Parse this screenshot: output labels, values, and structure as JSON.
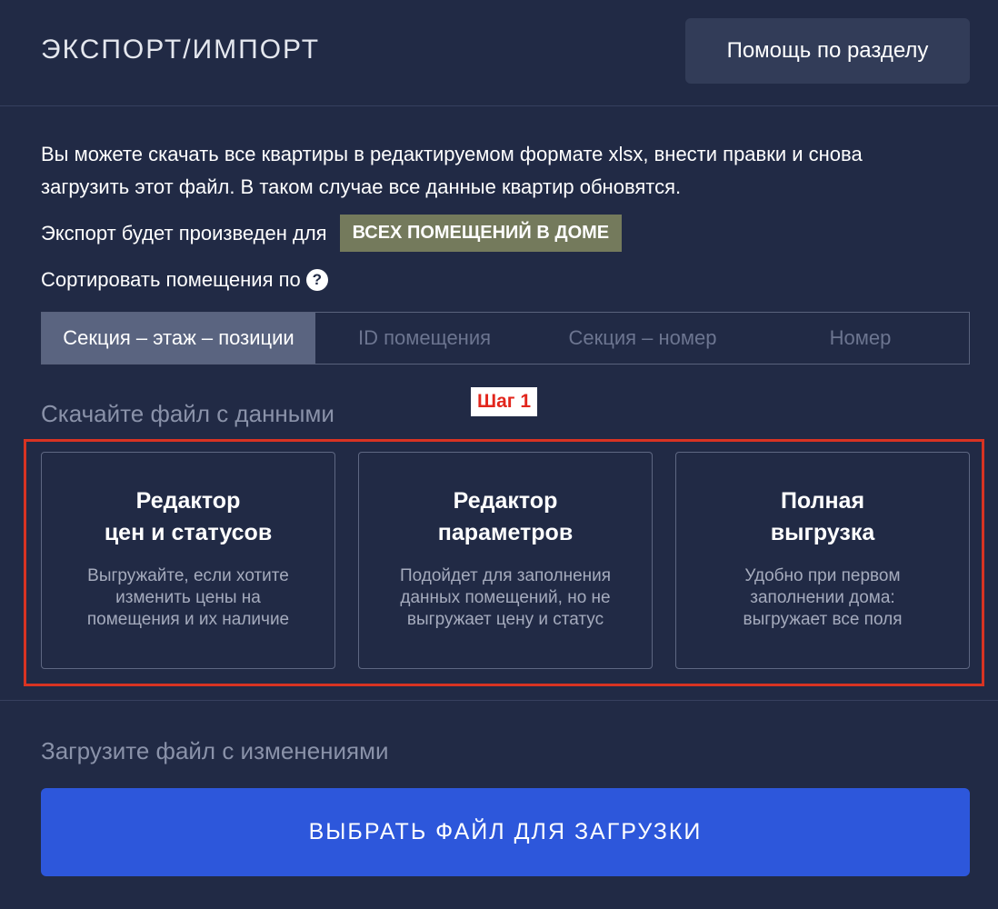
{
  "header": {
    "title": "ЭКСПОРТ/ИМПОРТ",
    "help_button": "Помощь по разделу"
  },
  "description": {
    "line1": "Вы можете скачать все квартиры в редактируемом формате xlsx, внести правки и снова",
    "line2": "загрузить этот файл. В таком случае все данные квартир обновятся."
  },
  "export_scope": {
    "label": "Экспорт будет произведен для",
    "badge": "ВСЕХ ПОМЕЩЕНИЙ В ДОМЕ"
  },
  "sort": {
    "label": "Сортировать помещения по",
    "help_icon": "question-circle-icon",
    "help_glyph": "?",
    "tabs": [
      {
        "label": "Секция – этаж – позиции",
        "active": true
      },
      {
        "label": "ID помещения",
        "active": false
      },
      {
        "label": "Секция – номер",
        "active": false
      },
      {
        "label": "Номер",
        "active": false
      }
    ]
  },
  "download": {
    "heading": "Скачайте файл с данными",
    "step_label": "Шаг 1",
    "cards": [
      {
        "title_lines": [
          "Редактор",
          "цен и статусов"
        ],
        "desc_lines": [
          "Выгружайте, если хотите",
          "изменить цены на",
          "помещения и их наличие"
        ]
      },
      {
        "title_lines": [
          "Редактор",
          "параметров"
        ],
        "desc_lines": [
          "Подойдет для заполнения",
          "данных помещений, но не",
          "выгружает цену и статус"
        ]
      },
      {
        "title_lines": [
          "Полная",
          "выгрузка"
        ],
        "desc_lines": [
          "Удобно при первом",
          "заполнении дома:",
          "выгружает все поля"
        ]
      }
    ]
  },
  "upload": {
    "heading": "Загрузите файл с изменениями",
    "button": "ВЫБРАТЬ ФАЙЛ ДЛЯ ЗАГРУЗКИ"
  },
  "colors": {
    "background": "#212a45",
    "accent_blue": "#2d57db",
    "badge_olive": "#747a5c",
    "highlight_red": "#d83322"
  }
}
